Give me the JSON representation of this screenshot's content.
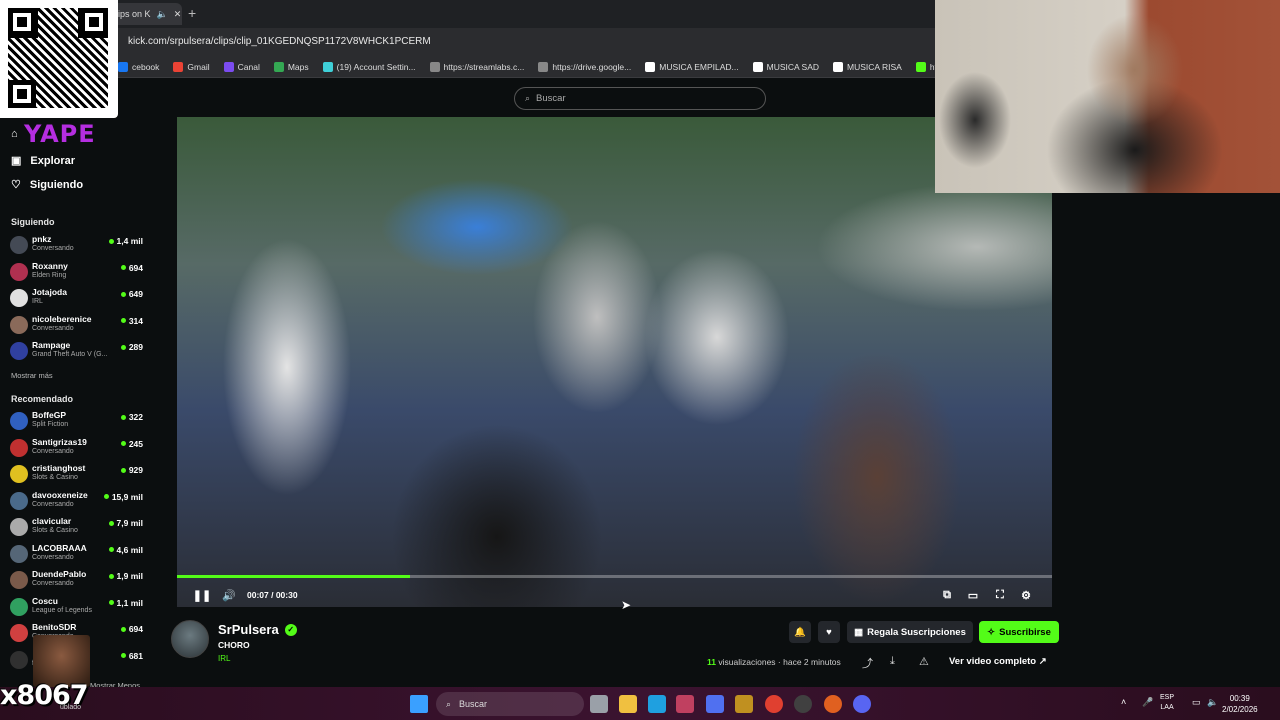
{
  "browser": {
    "tab_title": "ips on K",
    "url": "kick.com/srpulsera/clips/clip_01KGEDNQSP1172V8WHCK1PCERM",
    "bookmarks": [
      {
        "label": "cebook",
        "color": "#1877f2"
      },
      {
        "label": "Gmail",
        "color": "#ea4335"
      },
      {
        "label": "Canal",
        "color": "#7b4cf0"
      },
      {
        "label": "Maps",
        "color": "#34a853"
      },
      {
        "label": "(19) Account Settin...",
        "color": "#3fd0d8"
      },
      {
        "label": "https://streamlabs.c...",
        "color": "#888888"
      },
      {
        "label": "https://drive.google...",
        "color": "#888888"
      },
      {
        "label": "MUSICA EMPILAD...",
        "color": "#ffffff"
      },
      {
        "label": "MUSICA SAD",
        "color": "#ffffff"
      },
      {
        "label": "MUSICA RISA",
        "color": "#ffffff"
      },
      {
        "label": "https://kick.com/jef",
        "color": "#53fc18"
      }
    ]
  },
  "search": {
    "placeholder": "Buscar"
  },
  "sidebar": {
    "logo": "YAPE",
    "nav": [
      {
        "label": "Explorar",
        "icon": "compass-icon"
      },
      {
        "label": "Siguiendo",
        "icon": "heart-icon"
      }
    ],
    "following_title": "Siguiendo",
    "following": [
      {
        "name": "pnkz",
        "category": "Conversando",
        "viewers": "1,4 mil",
        "color": "#444a55"
      },
      {
        "name": "Roxanny",
        "category": "Elden Ring",
        "viewers": "694",
        "color": "#b03050"
      },
      {
        "name": "Jotajoda",
        "category": "IRL",
        "viewers": "649",
        "color": "#e0e0e0"
      },
      {
        "name": "nicoleberenice",
        "category": "Conversando",
        "viewers": "314",
        "color": "#8a6a5a"
      },
      {
        "name": "Rampage",
        "category": "Grand Theft Auto V (G...",
        "viewers": "289",
        "color": "#3040a0"
      }
    ],
    "show_more": "Mostrar más",
    "recommended_title": "Recomendado",
    "recommended": [
      {
        "name": "BoffeGP",
        "category": "Split Fiction",
        "viewers": "322",
        "color": "#3060c0"
      },
      {
        "name": "Santigrizas19",
        "category": "Conversando",
        "viewers": "245",
        "color": "#c03030"
      },
      {
        "name": "cristianghost",
        "category": "Slots & Casino",
        "viewers": "929",
        "color": "#e0c020"
      },
      {
        "name": "davooxeneize",
        "category": "Conversando",
        "viewers": "15,9 mil",
        "color": "#4a6a8a"
      },
      {
        "name": "clavicular",
        "category": "Slots & Casino",
        "viewers": "7,9 mil",
        "color": "#aaaaaa"
      },
      {
        "name": "LACOBRAAA",
        "category": "Conversando",
        "viewers": "4,6 mil",
        "color": "#556677"
      },
      {
        "name": "DuendePablo",
        "category": "Conversando",
        "viewers": "1,9 mil",
        "color": "#7a5a4a"
      },
      {
        "name": "Coscu",
        "category": "League of Legends",
        "viewers": "1,1 mil",
        "color": "#30a060"
      },
      {
        "name": "BenitoSDR",
        "category": "Conversando",
        "viewers": "694",
        "color": "#d04040"
      },
      {
        "name": "",
        "category": "ft Auto V (G...",
        "viewers": "681",
        "color": "#303030"
      }
    ],
    "show_less": "Mostrar Menos"
  },
  "player": {
    "time": "00:07 / 00:30",
    "progress": 0.266
  },
  "clip": {
    "channel": "SrPulsera",
    "title": "CHORO",
    "category": "IRL",
    "views_count": "11",
    "views_label": "visualizaciones",
    "ago": "hace 2 minutos",
    "gift_label": "Regala Suscripciones",
    "subscribe_label": "Suscribirse",
    "full_video_label": "Ver video completo"
  },
  "overlay": {
    "counter": "x8067",
    "doblado": "ublado"
  },
  "taskbar": {
    "search": "Buscar",
    "lang_top": "ESP",
    "lang_bottom": "LAA",
    "time": "00:39",
    "date": "2/02/2026",
    "apps": [
      {
        "name": "windows-icon",
        "color": "#3aa0ff"
      },
      {
        "name": "taskview-icon",
        "color": "#9aa0a8"
      },
      {
        "name": "files-icon",
        "color": "#f0c040"
      },
      {
        "name": "edge-icon",
        "color": "#1fa0e0"
      },
      {
        "name": "app-icon",
        "color": "#c04060"
      },
      {
        "name": "copilot-icon",
        "color": "#5070f0"
      },
      {
        "name": "game-icon",
        "color": "#c09020"
      },
      {
        "name": "chrome-icon",
        "color": "#e04030"
      },
      {
        "name": "obs-icon",
        "color": "#404040"
      },
      {
        "name": "chrome-profile-icon",
        "color": "#e06020"
      },
      {
        "name": "discord-icon",
        "color": "#5865f2"
      }
    ]
  }
}
